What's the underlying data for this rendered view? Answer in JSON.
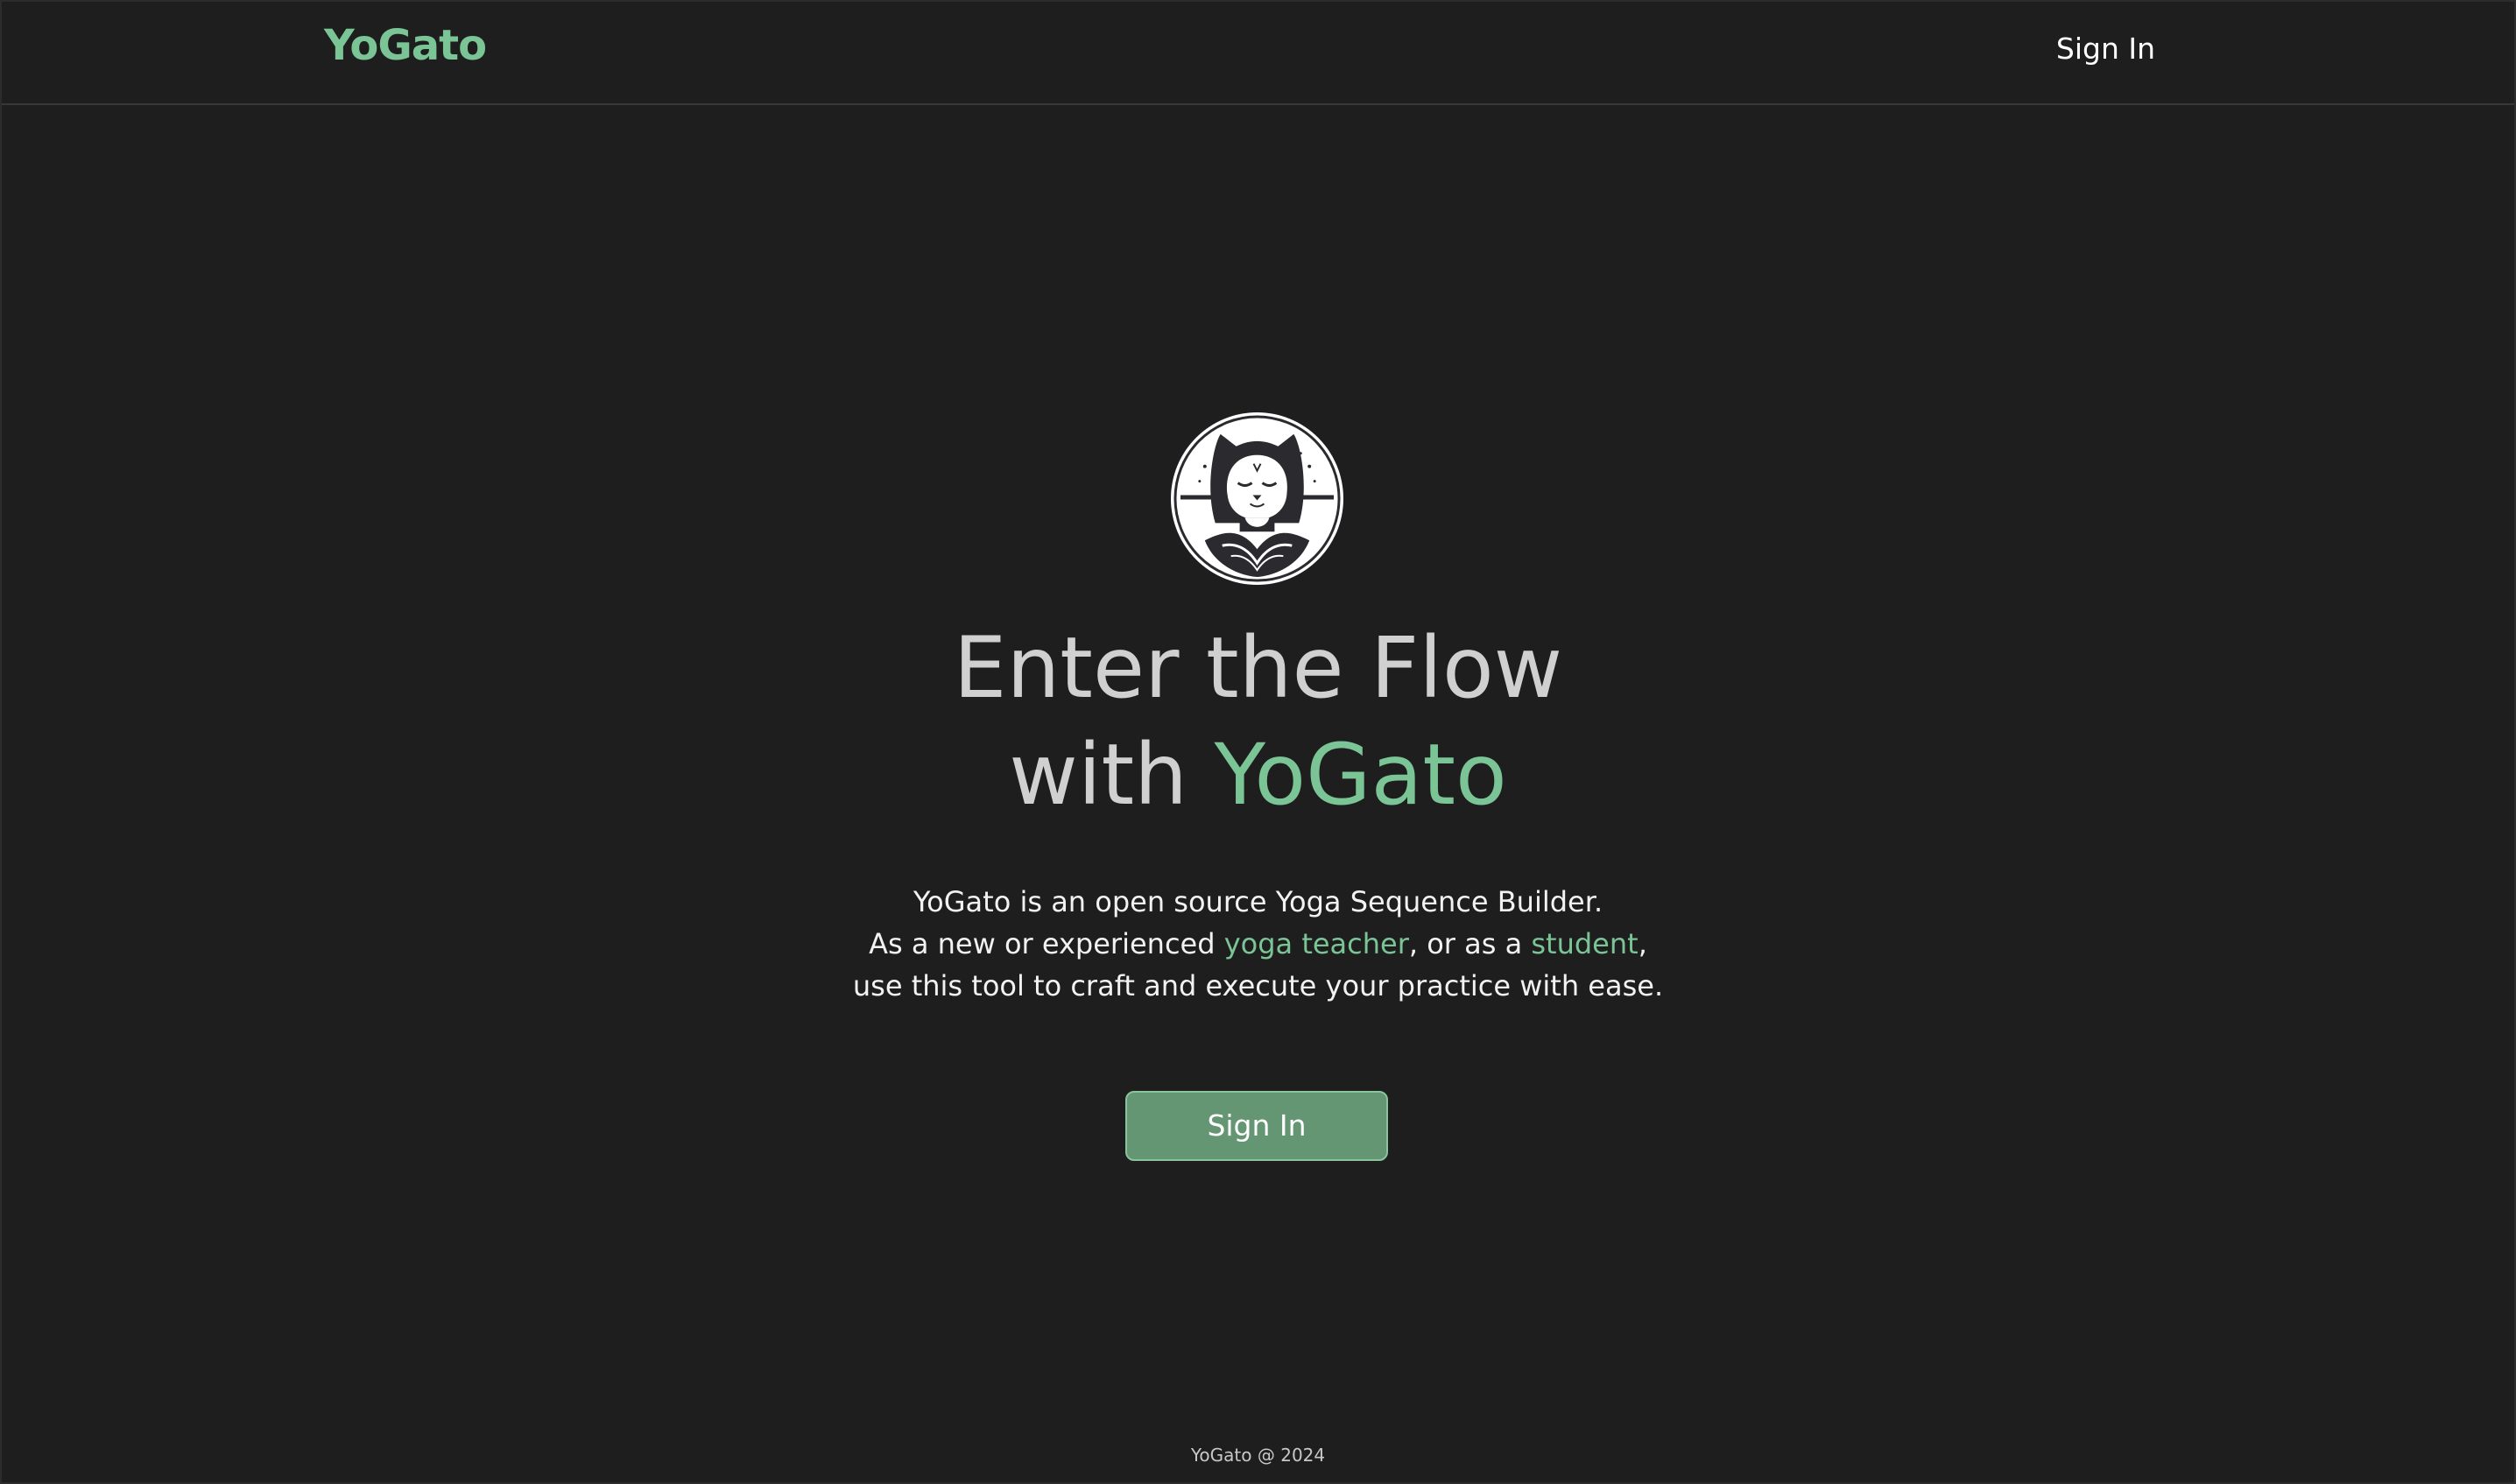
{
  "navbar": {
    "brand": "YoGato",
    "signin_label": "Sign In"
  },
  "hero": {
    "logo_icon": "meditating-cat-logo-icon",
    "headline_line1": "Enter the Flow",
    "headline_with": "with",
    "headline_brand": "YoGato",
    "description": {
      "line1": "YoGato is an open source Yoga Sequence Builder.",
      "line2_before": "As a new or experienced",
      "link_teacher": "yoga teacher",
      "line2_middle": ", or as a",
      "link_student": "student",
      "line2_after": ",",
      "line3": "use this tool to craft and execute your practice with ease."
    },
    "cta_label": "Sign In"
  },
  "footer": {
    "text": "YoGato @ 2024"
  },
  "colors": {
    "background": "#1e1e1e",
    "accent": "#7bc496",
    "button": "#659674"
  }
}
